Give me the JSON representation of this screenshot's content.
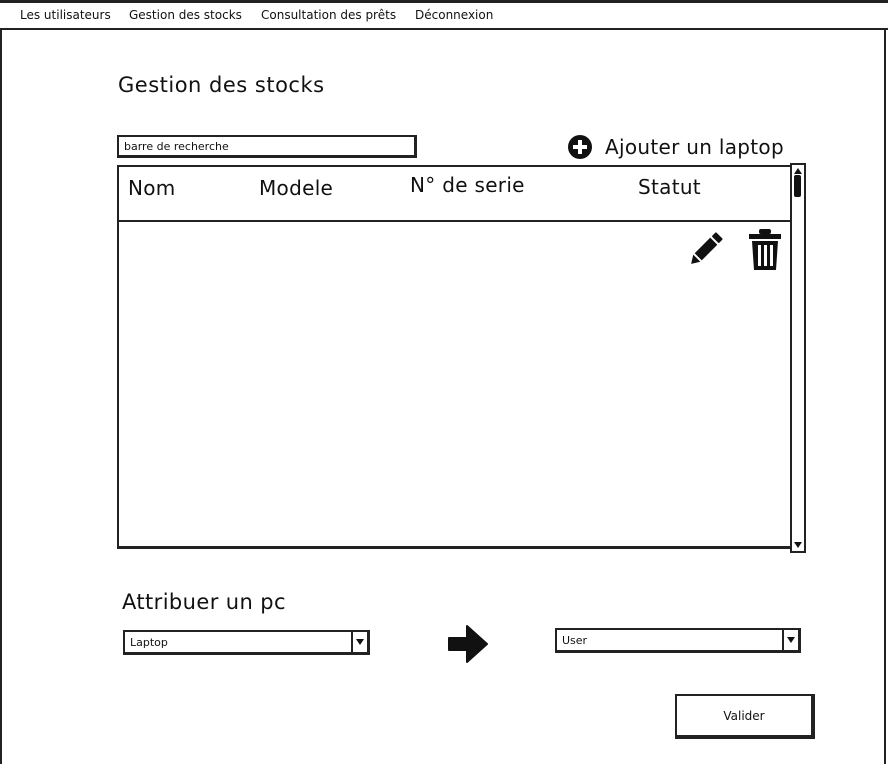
{
  "menu": {
    "items": [
      {
        "label": "Les utilisateurs"
      },
      {
        "label": "Gestion des stocks"
      },
      {
        "label": "Consultation des prêts"
      },
      {
        "label": "Déconnexion"
      }
    ]
  },
  "page": {
    "title": "Gestion des stocks"
  },
  "search": {
    "placeholder": "barre de recherche"
  },
  "add_button": {
    "label": "Ajouter un laptop",
    "icon": "plus-circle-icon"
  },
  "table": {
    "columns": [
      {
        "label": "Nom"
      },
      {
        "label": "Modele"
      },
      {
        "label": "N° de serie"
      },
      {
        "label": "Statut"
      }
    ],
    "row_actions": [
      {
        "icon": "pencil-icon"
      },
      {
        "icon": "trash-icon"
      }
    ]
  },
  "assign": {
    "title": "Attribuer un pc",
    "laptop_select": {
      "value": "Laptop"
    },
    "user_select": {
      "value": "User"
    },
    "arrow_icon": "arrow-right-icon",
    "submit_label": "Valider"
  }
}
